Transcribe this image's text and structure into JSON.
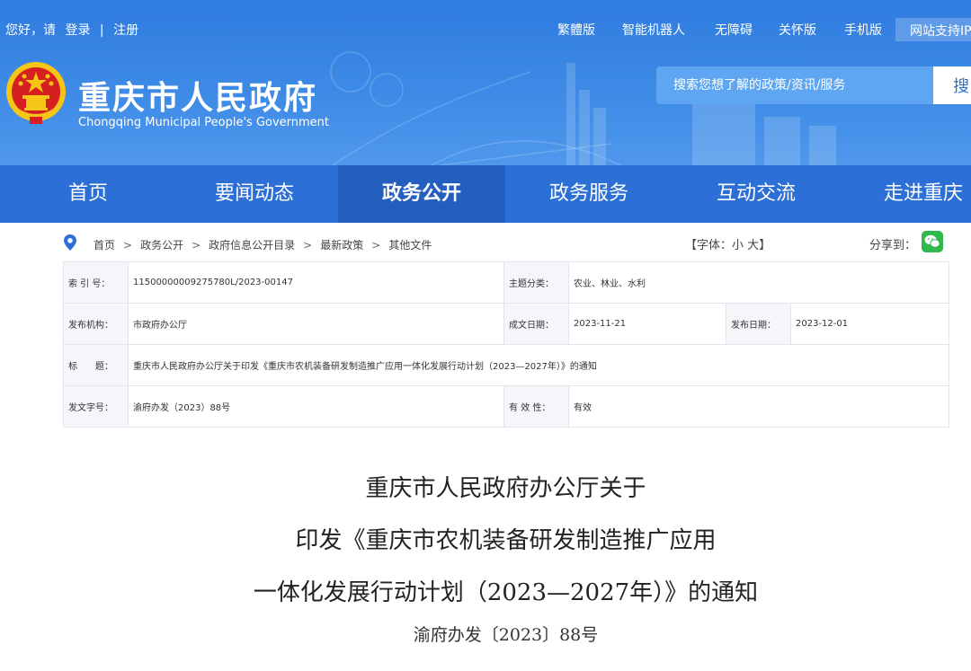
{
  "topbar": {
    "greeting": "您好，请",
    "login": "登录",
    "divider": "|",
    "register": "注册",
    "links": [
      "繁體版",
      "智能机器人",
      "无障碍",
      "关怀版",
      "手机版"
    ],
    "support": "网站支持IP"
  },
  "brand": {
    "title": "重庆市人民政府",
    "subtitle": "Chongqing Municipal People's Government"
  },
  "search": {
    "placeholder": "搜索您想了解的政策/资讯/服务",
    "button_label": "搜"
  },
  "nav": {
    "items": [
      "首页",
      "要闻动态",
      "政务公开",
      "政务服务",
      "互动交流",
      "走进重庆"
    ],
    "active": "政务公开"
  },
  "breadcrumb": {
    "items": [
      "首页",
      "政务公开",
      "政府信息公开目录",
      "最新政策",
      "其他文件"
    ],
    "separator": ">"
  },
  "font_control": {
    "open": "【字体：",
    "small": "小",
    "large": "大",
    "close": "】"
  },
  "share": {
    "label": "分享到："
  },
  "info": {
    "index_label": "索 引 号：",
    "index_value": "11500000009275780L/2023-00147",
    "topic_label": "主题分类：",
    "topic_value": "农业、林业、水利",
    "issuer_label": "发布机构：",
    "issuer_value": "市政府办公厅",
    "written_label": "成文日期：",
    "written_value": "2023-11-21",
    "published_label": "发布日期：",
    "published_value": "2023-12-01",
    "title_label": "标　　题：",
    "title_value": "重庆市人民政府办公厅关于印发《重庆市农机装备研发制造推广应用一体化发展行动计划（2023—2027年）》的通知",
    "docno_label": "发文字号：",
    "docno_value": "渝府办发（2023）88号",
    "validity_label": "有 效 性：",
    "validity_value": "有效"
  },
  "document": {
    "title_lines": [
      "重庆市人民政府办公厅关于",
      "印发《重庆市农机装备研发制造推广应用",
      "一体化发展行动计划（2023—2027年）》的通知"
    ],
    "number": "渝府办发〔2023〕88号"
  },
  "colors": {
    "header_blue": "#3d8ae6",
    "nav_blue": "#2c6fd6",
    "nav_active": "#245fc0",
    "emblem_red": "#d61f1f",
    "emblem_gold": "#f5c518",
    "wechat_green": "#2fb84c"
  },
  "icons": {
    "location": "location-pin-icon",
    "wechat": "wechat-icon",
    "emblem": "national-emblem-icon"
  }
}
